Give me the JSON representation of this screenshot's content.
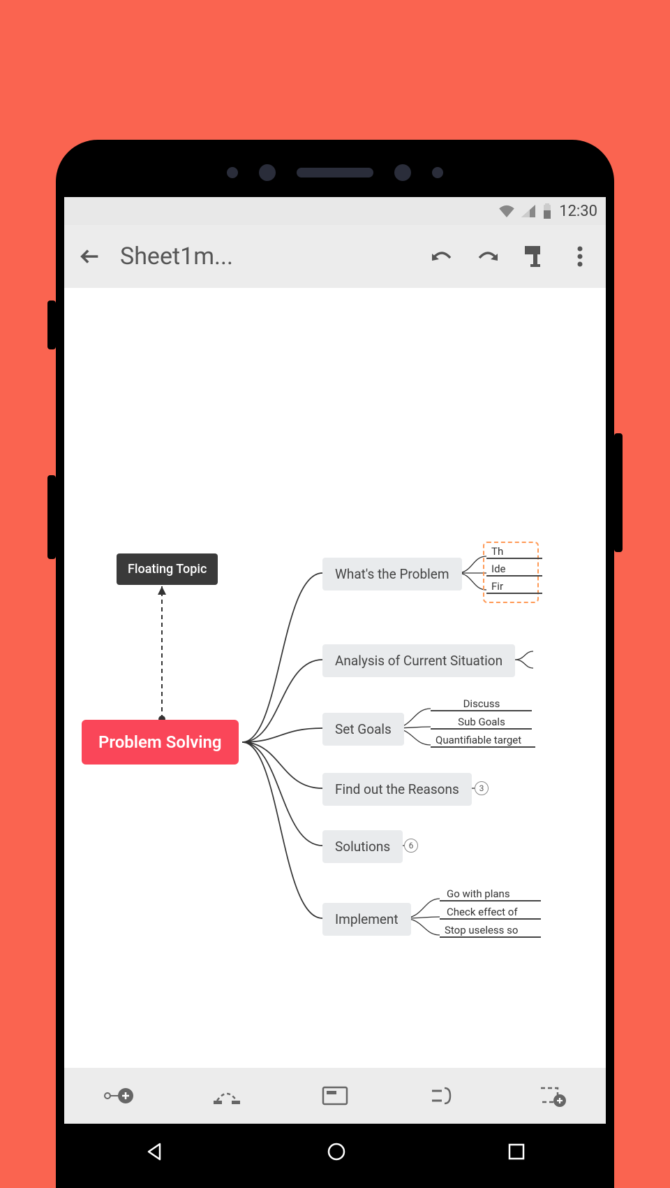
{
  "status": {
    "time": "12:30"
  },
  "appbar": {
    "title": "Sheet1m..."
  },
  "mindmap": {
    "central": "Problem Solving",
    "floating": "Floating Topic",
    "branches": [
      {
        "label": "What's the Problem",
        "subs": [
          "Th",
          "Ide",
          "Fir"
        ],
        "selected": true
      },
      {
        "label": "Analysis of Current Situation"
      },
      {
        "label": "Set Goals",
        "subs": [
          "Discuss",
          "Sub Goals",
          "Quantifiable target"
        ]
      },
      {
        "label": "Find out the Reasons",
        "count": "3"
      },
      {
        "label": "Solutions",
        "count": "6"
      },
      {
        "label": "Implement",
        "subs": [
          "Go with plans",
          "Check effect of",
          "Stop useless so"
        ]
      }
    ]
  }
}
